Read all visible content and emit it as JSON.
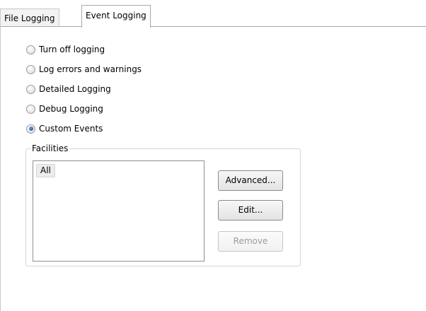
{
  "tabs": [
    {
      "label": "File Logging",
      "active": false
    },
    {
      "label": "Event Logging",
      "active": true
    }
  ],
  "logging_options": [
    {
      "label": "Turn off logging",
      "checked": false
    },
    {
      "label": "Log errors and warnings",
      "checked": false
    },
    {
      "label": "Detailed Logging",
      "checked": false
    },
    {
      "label": "Debug Logging",
      "checked": false
    },
    {
      "label": "Custom Events",
      "checked": true
    }
  ],
  "facilities": {
    "legend": "Facilities",
    "items": [
      "All"
    ],
    "buttons": {
      "advanced": "Advanced...",
      "edit": "Edit...",
      "remove": "Remove"
    },
    "remove_enabled": false
  }
}
